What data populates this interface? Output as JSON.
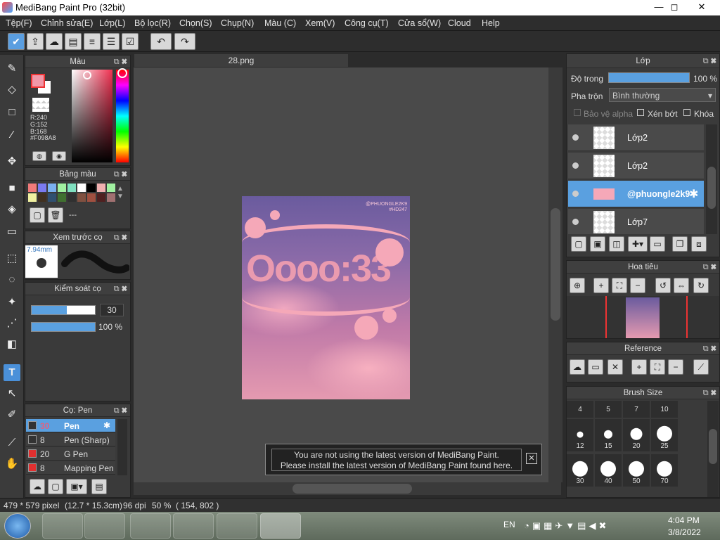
{
  "window": {
    "title": "MediBang Paint Pro (32bit)",
    "min": "—",
    "max": "◻",
    "close": "✕"
  },
  "menu": [
    "Tệp(F)",
    "Chỉnh sửa(E)",
    "Lớp(L)",
    "Bộ lọc(R)",
    "Chọn(S)",
    "Chụp(N)",
    "Màu (C)",
    "Xem(V)",
    "Công cụ(T)",
    "Cửa sổ(W)",
    "Cloud",
    "Help"
  ],
  "toolbar_icons": [
    "check-icon",
    "upload-icon",
    "chat-icon",
    "page-icon",
    "document-icon",
    "list-icon",
    "checklist-icon",
    "undo-icon",
    "redo-icon"
  ],
  "color_panel": {
    "title": "Màu",
    "r": "R:240",
    "g": "G:152",
    "b": "B:168",
    "hex": "#F098A8",
    "fg": "#F098A8"
  },
  "palette_panel": {
    "title": "Bảng màu",
    "name": "---",
    "swatches": [
      "#f07a7a",
      "#7a7af0",
      "#7ab0f0",
      "#a0f0a0",
      "#80e0c0",
      "#ffffff",
      "#000000",
      "#f0b0b0",
      "#a0f0a0",
      "#f0f0a0",
      "#403020",
      "#305070",
      "#407030",
      "#303030",
      "#805040",
      "#a05040",
      "#502020",
      "#a07070"
    ]
  },
  "brush_preview": {
    "title": "Xem trước cọ",
    "size": "7.94mm"
  },
  "brush_control": {
    "title": "Kiểm soát cọ",
    "size": "30",
    "opacity": "100 %",
    "size_frac": 0.55,
    "opacity_frac": 1.0
  },
  "brush_list": {
    "title": "Cọ: Pen",
    "items": [
      {
        "size": "30",
        "name": "Pen",
        "color": "#333333"
      },
      {
        "size": "8",
        "name": "Pen (Sharp)",
        "color": "#333333"
      },
      {
        "size": "20",
        "name": "G Pen",
        "color": "#e03030"
      },
      {
        "size": "8",
        "name": "Mapping Pen",
        "color": "#e03030"
      }
    ]
  },
  "document": {
    "tab": "28.png",
    "watermark_top": "@PHUONGLE2K9",
    "watermark_sub": "#HD247",
    "art_text": "Oooo:33"
  },
  "notification": {
    "line1": "You are not using the latest version of MediBang Paint.",
    "line2": "Please install the latest version of MediBang Paint found here.",
    "close": "✕"
  },
  "layers_panel": {
    "title": "Lớp",
    "opacity_label": "Độ trong",
    "opacity_value": "100 %",
    "opacity_frac": 1.0,
    "blend_label": "Pha trộn",
    "blend_value": "Bình thường",
    "protect_alpha": "Bảo vệ alpha",
    "clipping": "Xén bớt",
    "lock": "Khóa",
    "layers": [
      {
        "name": "Lớp2",
        "selected": false
      },
      {
        "name": "Lớp2",
        "selected": false
      },
      {
        "name": "@phuongle2k9",
        "selected": true
      },
      {
        "name": "Lớp7",
        "selected": false
      }
    ]
  },
  "navigator": {
    "title": "Hoa tiêu"
  },
  "reference": {
    "title": "Reference"
  },
  "brush_size": {
    "title": "Brush Size",
    "top_row": [
      "4",
      "5",
      "7",
      "10"
    ],
    "rows": [
      [
        "12",
        "15",
        "20",
        "25"
      ],
      [
        "30",
        "40",
        "50",
        "70"
      ]
    ],
    "dot_px": [
      [
        "9",
        "12",
        "17",
        "22"
      ],
      [
        "22",
        "22",
        "22",
        "22"
      ]
    ]
  },
  "status": {
    "size": "479 * 579 pixel",
    "cm": "(12.7 * 15.3cm)",
    "dpi": "96 dpi",
    "zoom": "50 %",
    "pos": "( 154, 802 )"
  },
  "taskbar": {
    "lang": "EN",
    "time": "4:04 PM",
    "date": "3/8/2022"
  }
}
